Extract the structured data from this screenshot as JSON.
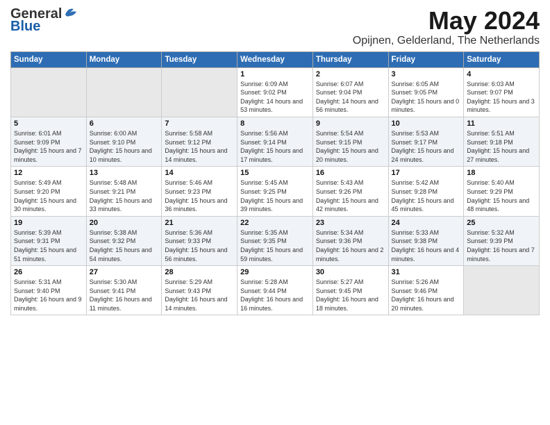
{
  "logo": {
    "general": "General",
    "blue": "Blue"
  },
  "title": "May 2024",
  "location": "Opijnen, Gelderland, The Netherlands",
  "days_header": [
    "Sunday",
    "Monday",
    "Tuesday",
    "Wednesday",
    "Thursday",
    "Friday",
    "Saturday"
  ],
  "weeks": [
    [
      {
        "day": "",
        "info": ""
      },
      {
        "day": "",
        "info": ""
      },
      {
        "day": "",
        "info": ""
      },
      {
        "day": "1",
        "info": "Sunrise: 6:09 AM\nSunset: 9:02 PM\nDaylight: 14 hours and 53 minutes."
      },
      {
        "day": "2",
        "info": "Sunrise: 6:07 AM\nSunset: 9:04 PM\nDaylight: 14 hours and 56 minutes."
      },
      {
        "day": "3",
        "info": "Sunrise: 6:05 AM\nSunset: 9:05 PM\nDaylight: 15 hours and 0 minutes."
      },
      {
        "day": "4",
        "info": "Sunrise: 6:03 AM\nSunset: 9:07 PM\nDaylight: 15 hours and 3 minutes."
      }
    ],
    [
      {
        "day": "5",
        "info": "Sunrise: 6:01 AM\nSunset: 9:09 PM\nDaylight: 15 hours and 7 minutes."
      },
      {
        "day": "6",
        "info": "Sunrise: 6:00 AM\nSunset: 9:10 PM\nDaylight: 15 hours and 10 minutes."
      },
      {
        "day": "7",
        "info": "Sunrise: 5:58 AM\nSunset: 9:12 PM\nDaylight: 15 hours and 14 minutes."
      },
      {
        "day": "8",
        "info": "Sunrise: 5:56 AM\nSunset: 9:14 PM\nDaylight: 15 hours and 17 minutes."
      },
      {
        "day": "9",
        "info": "Sunrise: 5:54 AM\nSunset: 9:15 PM\nDaylight: 15 hours and 20 minutes."
      },
      {
        "day": "10",
        "info": "Sunrise: 5:53 AM\nSunset: 9:17 PM\nDaylight: 15 hours and 24 minutes."
      },
      {
        "day": "11",
        "info": "Sunrise: 5:51 AM\nSunset: 9:18 PM\nDaylight: 15 hours and 27 minutes."
      }
    ],
    [
      {
        "day": "12",
        "info": "Sunrise: 5:49 AM\nSunset: 9:20 PM\nDaylight: 15 hours and 30 minutes."
      },
      {
        "day": "13",
        "info": "Sunrise: 5:48 AM\nSunset: 9:21 PM\nDaylight: 15 hours and 33 minutes."
      },
      {
        "day": "14",
        "info": "Sunrise: 5:46 AM\nSunset: 9:23 PM\nDaylight: 15 hours and 36 minutes."
      },
      {
        "day": "15",
        "info": "Sunrise: 5:45 AM\nSunset: 9:25 PM\nDaylight: 15 hours and 39 minutes."
      },
      {
        "day": "16",
        "info": "Sunrise: 5:43 AM\nSunset: 9:26 PM\nDaylight: 15 hours and 42 minutes."
      },
      {
        "day": "17",
        "info": "Sunrise: 5:42 AM\nSunset: 9:28 PM\nDaylight: 15 hours and 45 minutes."
      },
      {
        "day": "18",
        "info": "Sunrise: 5:40 AM\nSunset: 9:29 PM\nDaylight: 15 hours and 48 minutes."
      }
    ],
    [
      {
        "day": "19",
        "info": "Sunrise: 5:39 AM\nSunset: 9:31 PM\nDaylight: 15 hours and 51 minutes."
      },
      {
        "day": "20",
        "info": "Sunrise: 5:38 AM\nSunset: 9:32 PM\nDaylight: 15 hours and 54 minutes."
      },
      {
        "day": "21",
        "info": "Sunrise: 5:36 AM\nSunset: 9:33 PM\nDaylight: 15 hours and 56 minutes."
      },
      {
        "day": "22",
        "info": "Sunrise: 5:35 AM\nSunset: 9:35 PM\nDaylight: 15 hours and 59 minutes."
      },
      {
        "day": "23",
        "info": "Sunrise: 5:34 AM\nSunset: 9:36 PM\nDaylight: 16 hours and 2 minutes."
      },
      {
        "day": "24",
        "info": "Sunrise: 5:33 AM\nSunset: 9:38 PM\nDaylight: 16 hours and 4 minutes."
      },
      {
        "day": "25",
        "info": "Sunrise: 5:32 AM\nSunset: 9:39 PM\nDaylight: 16 hours and 7 minutes."
      }
    ],
    [
      {
        "day": "26",
        "info": "Sunrise: 5:31 AM\nSunset: 9:40 PM\nDaylight: 16 hours and 9 minutes."
      },
      {
        "day": "27",
        "info": "Sunrise: 5:30 AM\nSunset: 9:41 PM\nDaylight: 16 hours and 11 minutes."
      },
      {
        "day": "28",
        "info": "Sunrise: 5:29 AM\nSunset: 9:43 PM\nDaylight: 16 hours and 14 minutes."
      },
      {
        "day": "29",
        "info": "Sunrise: 5:28 AM\nSunset: 9:44 PM\nDaylight: 16 hours and 16 minutes."
      },
      {
        "day": "30",
        "info": "Sunrise: 5:27 AM\nSunset: 9:45 PM\nDaylight: 16 hours and 18 minutes."
      },
      {
        "day": "31",
        "info": "Sunrise: 5:26 AM\nSunset: 9:46 PM\nDaylight: 16 hours and 20 minutes."
      },
      {
        "day": "",
        "info": ""
      }
    ]
  ]
}
